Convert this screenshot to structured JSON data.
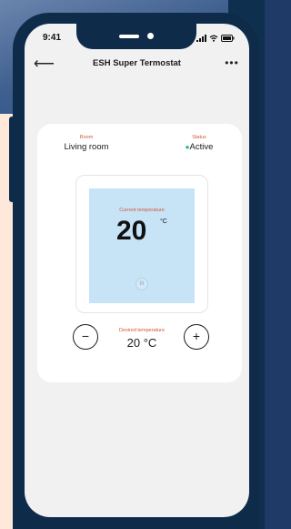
{
  "status_bar": {
    "time": "9:41"
  },
  "header": {
    "title": "ESH Super Termostat",
    "more_glyph": "•••",
    "back_glyph": "⟵"
  },
  "card": {
    "room_label": "Room",
    "room_value": "Living room",
    "status_label": "Status",
    "status_value": "Active",
    "status_color": "#2bb673",
    "current_label": "Current temperature",
    "current_value": "20",
    "current_unit": "°C",
    "display_button_glyph": "III",
    "desired_label": "Desired temperature",
    "desired_value": "20 °C",
    "minus_glyph": "−",
    "plus_glyph": "+"
  },
  "colors": {
    "accent_label": "#d1573a",
    "display_bg": "#c7e3f6",
    "phone_frame": "#0e2b4a"
  }
}
